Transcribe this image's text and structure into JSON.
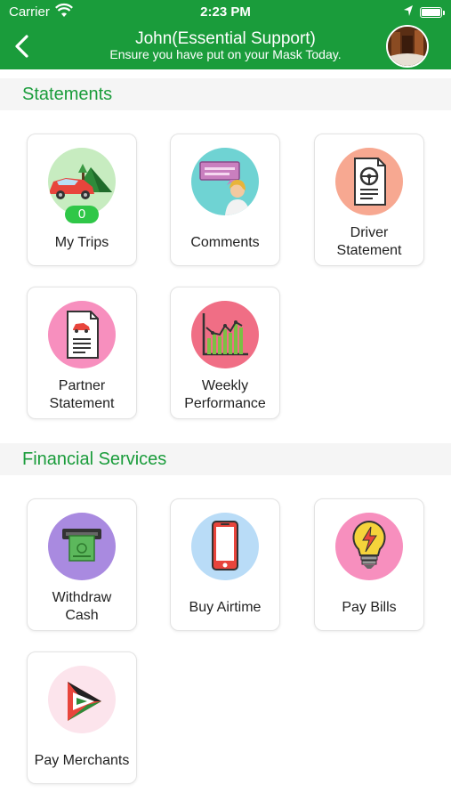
{
  "status_bar": {
    "carrier": "Carrier",
    "time": "2:23 PM"
  },
  "header": {
    "title": "John(Essential Support)",
    "subtitle": "Ensure you have put on your Mask Today."
  },
  "sections": {
    "statements": "Statements",
    "financial": "Financial Services"
  },
  "tiles": {
    "my_trips": {
      "label": "My Trips",
      "badge": "0"
    },
    "comments": {
      "label": "Comments"
    },
    "driver_statement": {
      "line1": "Driver",
      "line2": "Statement"
    },
    "partner_statement": {
      "line1": "Partner",
      "line2": "Statement"
    },
    "weekly_performance": {
      "line1": "Weekly",
      "line2": "Performance"
    },
    "withdraw_cash": {
      "line1": "Withdraw",
      "line2": "Cash"
    },
    "buy_airtime": {
      "label": "Buy Airtime"
    },
    "pay_bills": {
      "label": "Pay Bills"
    },
    "pay_merchants": {
      "label": "Pay Merchants"
    }
  },
  "colors": {
    "brand_green": "#1a9c3b",
    "badge_green": "#2fc748"
  },
  "icons": [
    "back-arrow-icon",
    "wifi-icon",
    "location-icon",
    "battery-icon",
    "car-trip-icon",
    "comments-icon",
    "driver-statement-icon",
    "partner-statement-icon",
    "performance-chart-icon",
    "withdraw-cash-icon",
    "mobile-phone-icon",
    "lightbulb-bills-icon",
    "pay-merchants-icon"
  ]
}
